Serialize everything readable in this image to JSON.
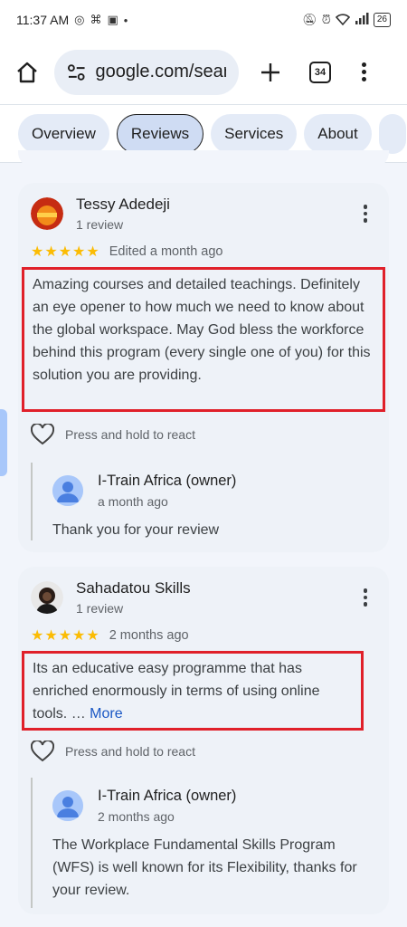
{
  "status_bar": {
    "time": "11:37 AM",
    "battery": "26"
  },
  "browser": {
    "url": "google.com/sear",
    "tab_count": "34",
    "icons": [
      "home-icon",
      "site-settings-icon",
      "plus-icon",
      "tabs-icon",
      "menu-icon"
    ]
  },
  "tabs": [
    {
      "label": "Overview",
      "active": false
    },
    {
      "label": "Reviews",
      "active": true
    },
    {
      "label": "Services",
      "active": false
    },
    {
      "label": "About",
      "active": false
    }
  ],
  "reviews": [
    {
      "name": "Tessy Adedeji",
      "count": "1 review",
      "stars": "★★★★★",
      "rating": 5,
      "date": "Edited a month ago",
      "text": "Amazing courses and detailed teachings. Definitely an eye opener to how much we need to know about the global workspace. May God bless the workforce behind this program (every single one of you) for this solution you are providing.",
      "react_label": "Press and hold to react",
      "owner": {
        "name": "I-Train Africa (owner)",
        "date": "a month ago",
        "reply": "Thank you for your review"
      }
    },
    {
      "name": "Sahadatou Skills",
      "count": "1 review",
      "stars": "★★★★★",
      "rating": 5,
      "date": "2 months ago",
      "text": "Its an educative easy programme that has enriched enormously in terms of using online tools. … ",
      "more_label": "More",
      "react_label": "Press and hold to react",
      "owner": {
        "name": "I-Train Africa (owner)",
        "date": "2 months ago",
        "reply": "The Workplace Fundamental Skills Program (WFS) is well known for its Flexibility, thanks for your review."
      }
    }
  ],
  "colors": {
    "highlight_border": "#e0202a",
    "star": "#fbbc04",
    "link": "#1a57c4"
  }
}
